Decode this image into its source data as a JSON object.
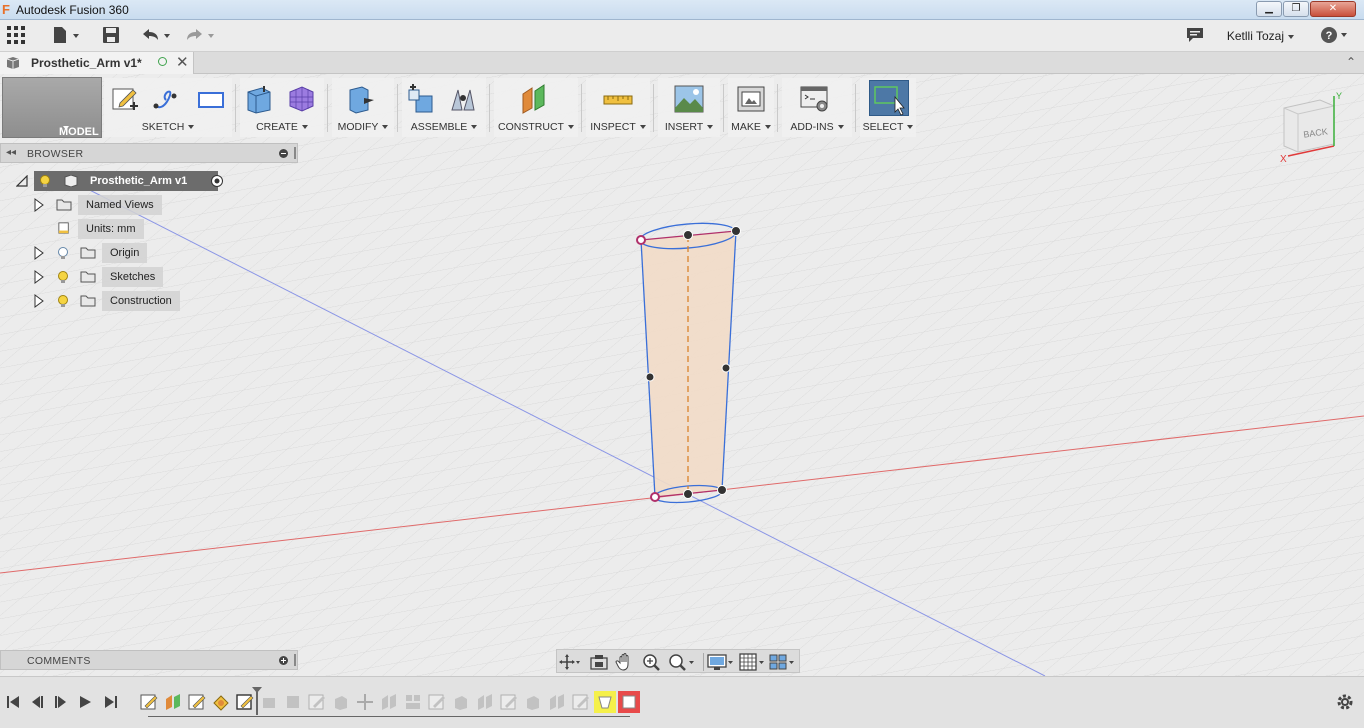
{
  "window": {
    "title": "Autodesk Fusion 360",
    "controls": [
      "minimize-icon",
      "restore-icon",
      "close-icon"
    ]
  },
  "quick_access": {
    "icons": [
      "app-grid-icon",
      "file-icon",
      "save-icon",
      "undo-icon",
      "redo-icon"
    ],
    "user_name": "Ketlli Tozaj",
    "help_icon": "help-icon",
    "comment_icon": "comment-icon"
  },
  "document_tab": {
    "name": "Prosthetic_Arm v1*"
  },
  "toolbar": {
    "workspace": "MODEL",
    "groups": [
      {
        "label": "SKETCH"
      },
      {
        "label": "CREATE"
      },
      {
        "label": "MODIFY"
      },
      {
        "label": "ASSEMBLE"
      },
      {
        "label": "CONSTRUCT"
      },
      {
        "label": "INSPECT"
      },
      {
        "label": "INSERT"
      },
      {
        "label": "MAKE"
      },
      {
        "label": "ADD-INS"
      },
      {
        "label": "SELECT"
      }
    ]
  },
  "browser": {
    "title": "BROWSER",
    "root": "Prosthetic_Arm v1",
    "items": [
      {
        "label": "Named Views"
      },
      {
        "label": "Units: mm"
      },
      {
        "label": "Origin"
      },
      {
        "label": "Sketches"
      },
      {
        "label": "Construction"
      }
    ]
  },
  "comments": {
    "title": "COMMENTS"
  },
  "viewcube": {
    "face_label": "BACK",
    "axis_x": "X",
    "axis_y": "Y"
  },
  "colors": {
    "axis_x": "#e05050",
    "axis_y": "#6f7fe0",
    "profile_fill": "#f2dcc8",
    "sketch_line": "#3a6fd8",
    "centerline": "#d9822b",
    "select_active": "#4d78a6"
  }
}
